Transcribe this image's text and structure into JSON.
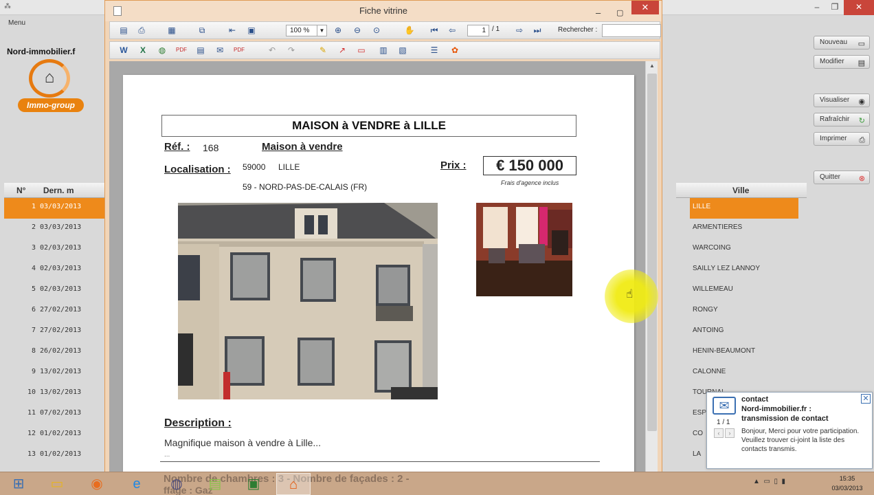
{
  "background": {
    "menu": "Menu",
    "logo_text": "Nord-immobilier.f",
    "logo_sub": "Immo-group",
    "buttons": [
      {
        "label": "Nouveau"
      },
      {
        "label": "Modifier"
      },
      {
        "label": "Visualiser"
      },
      {
        "label": "Rafraîchir"
      },
      {
        "label": "Imprimer"
      },
      {
        "label": "Quitter"
      }
    ],
    "list": {
      "col_num": "N°",
      "col_date": "Dern. m",
      "col_city": "Ville",
      "rows": [
        {
          "num": "1",
          "date": "03/03/2013",
          "city": "LILLE",
          "selected": true
        },
        {
          "num": "2",
          "date": "03/03/2013",
          "city": "ARMENTIERES"
        },
        {
          "num": "3",
          "date": "02/03/2013",
          "city": "WARCOING"
        },
        {
          "num": "4",
          "date": "02/03/2013",
          "city": "SAILLY LEZ LANNOY"
        },
        {
          "num": "5",
          "date": "02/03/2013",
          "city": "WILLEMEAU"
        },
        {
          "num": "6",
          "date": "27/02/2013",
          "city": "RONGY"
        },
        {
          "num": "7",
          "date": "27/02/2013",
          "city": "ANTOING"
        },
        {
          "num": "8",
          "date": "26/02/2013",
          "city": "HENIN-BEAUMONT"
        },
        {
          "num": "9",
          "date": "13/02/2013",
          "city": "CALONNE"
        },
        {
          "num": "10",
          "date": "13/02/2013",
          "city": "TOURNAI"
        },
        {
          "num": "11",
          "date": "07/02/2013",
          "city": "ESP"
        },
        {
          "num": "12",
          "date": "01/02/2013",
          "city": "CO"
        },
        {
          "num": "13",
          "date": "01/02/2013",
          "city": "LA"
        }
      ]
    }
  },
  "dialog": {
    "title": "Fiche vitrine",
    "toolbar": {
      "zoom": "100 %",
      "page_current": "1",
      "page_total": "/ 1",
      "search_label": "Rechercher :",
      "search_value": ""
    },
    "document": {
      "title": "MAISON à VENDRE à LILLE",
      "ref_label": "Réf. :",
      "ref_value": "168",
      "type": "Maison à vendre",
      "loc_label": "Localisation :",
      "postal_code": "59000",
      "city": "LILLE",
      "department": "59 - NORD-PAS-DE-CALAIS (FR)",
      "price_label": "Prix :",
      "price": "€ 150 000",
      "fees_note": "Frais d'agence inclus",
      "desc_label": "Description :",
      "desc_text": "Magnifique maison à vendre à Lille...",
      "desc_more": "..."
    }
  },
  "notification": {
    "title": "contact",
    "subtitle1": "Nord-immobilier.fr :",
    "subtitle2": "transmission de contact",
    "body": "Bonjour, Merci pour votre participation. Veuillez trouver ci-joint la liste des contacts transmis.",
    "count": "1 / 1"
  },
  "taskbar": {
    "ghost_line1": "Nombre de chambres : 3 - Nombre de façades : 2 -",
    "ghost_line2": "ffage : Gaz",
    "time": "15:35",
    "date": "03/03/2013"
  },
  "colors": {
    "accent": "#ee8a1b",
    "dialog_border": "#e09a55",
    "close_red": "#c9453a"
  }
}
